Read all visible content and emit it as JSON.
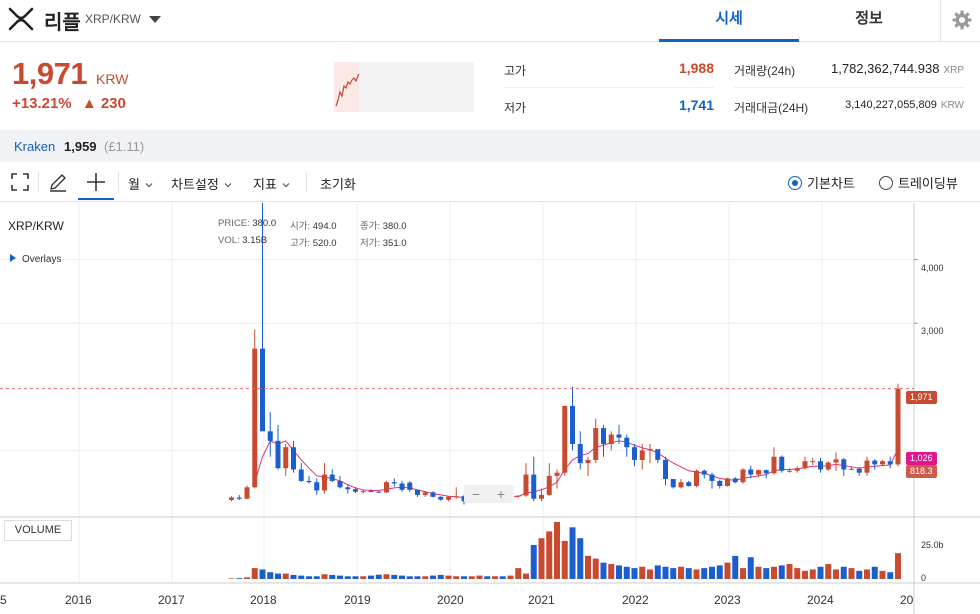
{
  "header": {
    "coin_name": "리플",
    "pair": "XRP/KRW",
    "tabs": [
      "시세",
      "정보"
    ]
  },
  "price": {
    "current": "1,971",
    "unit": "KRW",
    "change_pct": "+13.21%",
    "change_abs": "▲ 230"
  },
  "stats": {
    "high_label": "고가",
    "high_value": "1,988",
    "low_label": "저가",
    "low_value": "1,741",
    "volume_label": "거래량(24h)",
    "volume_value": "1,782,362,744.938",
    "volume_unit": "XRP",
    "amount_label": "거래대금(24H)",
    "amount_value": "3,140,227,055,809",
    "amount_unit": "KRW"
  },
  "exchange": {
    "name": "Kraken",
    "price": "1,959",
    "converted": "(£1.11)"
  },
  "toolbar": {
    "period": "월",
    "chart_settings": "차트설정",
    "indicators": "지표",
    "reset": "초기화",
    "basic_chart": "기본차트",
    "trading_view": "트레이딩뷰"
  },
  "chart": {
    "pane_title": "XRP/KRW",
    "overlays": "Overlays",
    "ohlc": {
      "price_label": "PRICE:",
      "price": "380.0",
      "vol_label": "VOL:",
      "vol": "3.15B",
      "open_label": "시가:",
      "open": "494.0",
      "high_label": "고가:",
      "high": "520.0",
      "close_label": "종가:",
      "close": "380.0",
      "low_label": "저가:",
      "low": "351.0"
    },
    "volume_button": "VOLUME",
    "zoom_out": "−",
    "zoom_in": "+",
    "price_tag_current": "1,971",
    "price_tag_ma": "1,026",
    "price_tag_low": "818.3",
    "y_ticks": [
      "4,000",
      "3,000"
    ],
    "vol_ticks": [
      "25.0b",
      "0"
    ],
    "x_ticks": [
      "5",
      "2016",
      "2017",
      "2018",
      "2019",
      "2020",
      "2021",
      "2022",
      "2023",
      "2024",
      "20"
    ],
    "colors": {
      "up": "#c84a31",
      "down": "#1b5fce",
      "ma": "#e0317a",
      "grid": "#eeeeee"
    }
  },
  "chart_data": {
    "type": "candlestick",
    "title": "XRP/KRW",
    "xlabel": "",
    "ylabel": "",
    "ylim": [
      0,
      4900
    ],
    "interval": "1M",
    "series": [
      {
        "name": "XRP/KRW",
        "ohlc": [
          [
            "2017-09",
            220,
            280,
            200,
            260
          ],
          [
            "2017-10",
            260,
            300,
            220,
            240
          ],
          [
            "2017-11",
            240,
            450,
            230,
            420
          ],
          [
            "2017-12",
            420,
            2900,
            400,
            2600
          ],
          [
            "2018-01",
            2600,
            4900,
            1800,
            1300
          ],
          [
            "2018-02",
            1300,
            1600,
            900,
            1150
          ],
          [
            "2018-03",
            1150,
            1400,
            700,
            720
          ],
          [
            "2018-04",
            720,
            1100,
            600,
            1050
          ],
          [
            "2018-05",
            1050,
            1150,
            650,
            700
          ],
          [
            "2018-06",
            700,
            800,
            500,
            520
          ],
          [
            "2018-07",
            520,
            600,
            480,
            500
          ],
          [
            "2018-08",
            500,
            560,
            300,
            370
          ],
          [
            "2018-09",
            370,
            800,
            320,
            620
          ],
          [
            "2018-10",
            620,
            700,
            500,
            520
          ],
          [
            "2018-11",
            520,
            600,
            400,
            420
          ],
          [
            "2018-12",
            420,
            450,
            320,
            390
          ],
          [
            "2019-01",
            390,
            420,
            330,
            350
          ],
          [
            "2019-02",
            350,
            380,
            320,
            360
          ],
          [
            "2019-03",
            360,
            390,
            350,
            350
          ],
          [
            "2019-04",
            350,
            360,
            330,
            340
          ],
          [
            "2019-05",
            340,
            520,
            330,
            500
          ],
          [
            "2019-06",
            500,
            560,
            430,
            480
          ],
          [
            "2019-07",
            480,
            520,
            350,
            380
          ],
          [
            "2019-08",
            494,
            520,
            351,
            380
          ],
          [
            "2019-09",
            380,
            380,
            270,
            300
          ],
          [
            "2019-10",
            300,
            360,
            270,
            340
          ],
          [
            "2019-11",
            340,
            360,
            260,
            270
          ],
          [
            "2019-12",
            270,
            280,
            210,
            225
          ],
          [
            "2020-01",
            225,
            280,
            200,
            270
          ],
          [
            "2020-02",
            270,
            420,
            240,
            280
          ],
          [
            "2020-03",
            280,
            300,
            150,
            200
          ],
          [
            "2020-04",
            200,
            240,
            170,
            230
          ],
          [
            "2020-05",
            230,
            250,
            210,
            230
          ],
          [
            "2020-06",
            230,
            240,
            200,
            210
          ],
          [
            "2020-07",
            210,
            300,
            200,
            290
          ],
          [
            "2020-08",
            290,
            360,
            270,
            280
          ],
          [
            "2020-09",
            280,
            300,
            230,
            280
          ],
          [
            "2020-10",
            280,
            290,
            260,
            290
          ],
          [
            "2020-11",
            290,
            800,
            270,
            620
          ],
          [
            "2020-12",
            620,
            900,
            200,
            240
          ],
          [
            "2021-01",
            240,
            400,
            200,
            300
          ],
          [
            "2021-02",
            300,
            800,
            280,
            600
          ],
          [
            "2021-03",
            600,
            700,
            400,
            650
          ],
          [
            "2021-04",
            650,
            1600,
            600,
            1700
          ],
          [
            "2021-05",
            1700,
            2000,
            1000,
            1100
          ],
          [
            "2021-06",
            1100,
            1300,
            700,
            800
          ],
          [
            "2021-07",
            800,
            900,
            600,
            850
          ],
          [
            "2021-08",
            850,
            1500,
            800,
            1350
          ],
          [
            "2021-09",
            1350,
            1400,
            900,
            1100
          ],
          [
            "2021-10",
            1100,
            1300,
            1000,
            1250
          ],
          [
            "2021-11",
            1250,
            1400,
            1100,
            1200
          ],
          [
            "2021-12",
            1200,
            1250,
            900,
            1050
          ],
          [
            "2022-01",
            1050,
            1100,
            750,
            850
          ],
          [
            "2022-02",
            850,
            1100,
            700,
            1000
          ],
          [
            "2022-03",
            1000,
            1100,
            800,
            1020
          ],
          [
            "2022-04",
            1020,
            1000,
            800,
            850
          ],
          [
            "2022-05",
            850,
            900,
            450,
            550
          ],
          [
            "2022-06",
            550,
            550,
            400,
            420
          ],
          [
            "2022-07",
            420,
            550,
            400,
            500
          ],
          [
            "2022-08",
            500,
            520,
            430,
            440
          ],
          [
            "2022-09",
            440,
            700,
            420,
            680
          ],
          [
            "2022-10",
            680,
            700,
            560,
            620
          ],
          [
            "2022-11",
            620,
            650,
            400,
            520
          ],
          [
            "2022-12",
            520,
            540,
            400,
            440
          ],
          [
            "2023-01",
            440,
            570,
            430,
            560
          ],
          [
            "2023-02",
            560,
            580,
            480,
            500
          ],
          [
            "2023-03",
            500,
            720,
            480,
            700
          ],
          [
            "2023-04",
            700,
            760,
            560,
            620
          ],
          [
            "2023-05",
            620,
            700,
            580,
            690
          ],
          [
            "2023-06",
            690,
            700,
            560,
            640
          ],
          [
            "2023-07",
            640,
            1050,
            620,
            900
          ],
          [
            "2023-08",
            900,
            920,
            650,
            680
          ],
          [
            "2023-09",
            680,
            720,
            650,
            680
          ],
          [
            "2023-10",
            680,
            750,
            650,
            720
          ],
          [
            "2023-11",
            720,
            900,
            700,
            830
          ],
          [
            "2023-12",
            830,
            880,
            770,
            830
          ],
          [
            "2024-01",
            830,
            880,
            650,
            700
          ],
          [
            "2024-02",
            700,
            830,
            680,
            810
          ],
          [
            "2024-03",
            810,
            970,
            680,
            860
          ],
          [
            "2024-04",
            860,
            880,
            600,
            700
          ],
          [
            "2024-05",
            700,
            750,
            690,
            710
          ],
          [
            "2024-06",
            710,
            740,
            600,
            650
          ],
          [
            "2024-07",
            650,
            900,
            600,
            840
          ],
          [
            "2024-08",
            840,
            860,
            700,
            780
          ],
          [
            "2024-09",
            780,
            850,
            760,
            830
          ],
          [
            "2024-10",
            830,
            900,
            720,
            780
          ],
          [
            "2024-11",
            780,
            2050,
            750,
            1971
          ]
        ]
      },
      {
        "name": "MA",
        "type": "line",
        "values": [
          [
            "2017-12",
            500
          ],
          [
            "2018-01",
            900
          ],
          [
            "2018-02",
            1150
          ],
          [
            "2018-03",
            1100
          ],
          [
            "2018-04",
            1150
          ],
          [
            "2018-05",
            1000
          ],
          [
            "2018-06",
            850
          ],
          [
            "2018-07",
            720
          ],
          [
            "2018-08",
            600
          ],
          [
            "2018-09",
            580
          ],
          [
            "2018-10",
            560
          ],
          [
            "2018-11",
            520
          ],
          [
            "2018-12",
            460
          ],
          [
            "2019-01",
            410
          ],
          [
            "2019-02",
            380
          ],
          [
            "2019-03",
            370
          ],
          [
            "2019-04",
            370
          ],
          [
            "2019-05",
            390
          ],
          [
            "2019-06",
            410
          ],
          [
            "2019-07",
            420
          ],
          [
            "2019-08",
            410
          ],
          [
            "2019-09",
            380
          ],
          [
            "2019-10",
            350
          ],
          [
            "2019-11",
            320
          ],
          [
            "2019-12",
            300
          ],
          [
            "2020-01",
            280
          ],
          [
            "2020-02",
            270
          ],
          [
            "2020-03",
            260
          ],
          [
            "2020-04",
            250
          ],
          [
            "2020-05",
            245
          ],
          [
            "2020-06",
            240
          ],
          [
            "2020-07",
            245
          ],
          [
            "2020-08",
            255
          ],
          [
            "2020-09",
            265
          ],
          [
            "2020-10",
            275
          ],
          [
            "2020-11",
            330
          ],
          [
            "2020-12",
            350
          ],
          [
            "2021-01",
            380
          ],
          [
            "2021-02",
            430
          ],
          [
            "2021-03",
            500
          ],
          [
            "2021-04",
            700
          ],
          [
            "2021-05",
            850
          ],
          [
            "2021-06",
            920
          ],
          [
            "2021-07",
            950
          ],
          [
            "2021-08",
            1050
          ],
          [
            "2021-09",
            1080
          ],
          [
            "2021-10",
            1120
          ],
          [
            "2021-11",
            1150
          ],
          [
            "2021-12",
            1130
          ],
          [
            "2022-01",
            1080
          ],
          [
            "2022-02",
            1040
          ],
          [
            "2022-03",
            1010
          ],
          [
            "2022-04",
            960
          ],
          [
            "2022-05",
            880
          ],
          [
            "2022-06",
            800
          ],
          [
            "2022-07",
            740
          ],
          [
            "2022-08",
            680
          ],
          [
            "2022-09",
            660
          ],
          [
            "2022-10",
            640
          ],
          [
            "2022-11",
            600
          ],
          [
            "2022-12",
            560
          ],
          [
            "2023-01",
            540
          ],
          [
            "2023-02",
            530
          ],
          [
            "2023-03",
            560
          ],
          [
            "2023-04",
            580
          ],
          [
            "2023-05",
            600
          ],
          [
            "2023-06",
            620
          ],
          [
            "2023-07",
            680
          ],
          [
            "2023-08",
            700
          ],
          [
            "2023-09",
            700
          ],
          [
            "2023-10",
            710
          ],
          [
            "2023-11",
            730
          ],
          [
            "2023-12",
            750
          ],
          [
            "2024-01",
            750
          ],
          [
            "2024-02",
            760
          ],
          [
            "2024-03",
            780
          ],
          [
            "2024-04",
            760
          ],
          [
            "2024-05",
            740
          ],
          [
            "2024-06",
            720
          ],
          [
            "2024-07",
            740
          ],
          [
            "2024-08",
            750
          ],
          [
            "2024-09",
            760
          ],
          [
            "2024-10",
            770
          ],
          [
            "2024-11",
            1026
          ]
        ]
      }
    ],
    "volume_b": [
      0.4,
      0.6,
      1.2,
      8,
      7,
      5,
      4,
      4,
      3,
      2.5,
      2,
      2,
      3.5,
      3,
      2.5,
      2,
      2,
      2,
      2.5,
      3.15,
      3.5,
      3,
      2.5,
      2,
      2,
      2,
      2.5,
      3,
      2.5,
      2,
      2,
      2,
      2.5,
      2,
      2,
      2,
      2.5,
      8,
      4,
      25,
      30,
      35,
      42,
      28,
      38,
      30,
      17,
      15,
      12,
      11,
      10,
      9,
      8,
      9,
      7,
      10,
      9,
      8,
      9,
      8,
      7,
      8,
      9,
      10,
      12,
      17,
      8,
      16,
      9,
      8,
      9,
      10,
      11,
      8,
      6,
      7,
      9,
      11,
      7,
      9,
      8,
      6,
      7,
      9,
      6,
      5,
      19
    ],
    "current_price": 1971,
    "ma_value": 1026,
    "low_marker": 818.3
  }
}
